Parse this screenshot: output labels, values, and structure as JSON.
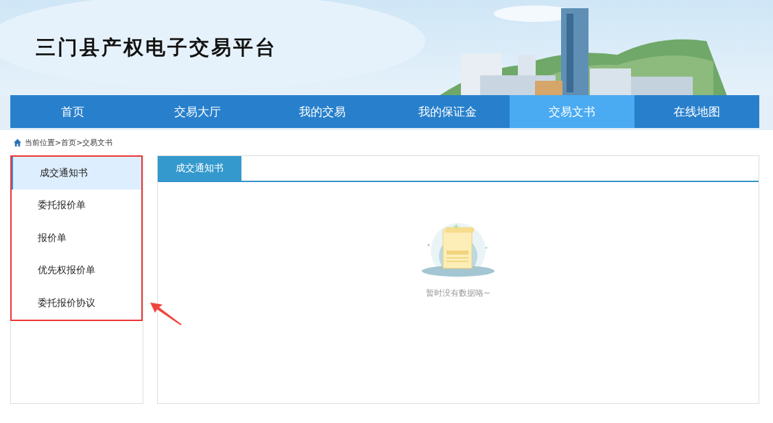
{
  "header": {
    "title": "三门县产权电子交易平台"
  },
  "nav": [
    {
      "label": "首页",
      "selected": false
    },
    {
      "label": "交易大厅",
      "selected": false
    },
    {
      "label": "我的交易",
      "selected": false
    },
    {
      "label": "我的保证金",
      "selected": false
    },
    {
      "label": "交易文书",
      "selected": true
    },
    {
      "label": "在线地图",
      "selected": false
    }
  ],
  "breadcrumb": "当前位置>首页>交易文书",
  "sidebar": {
    "highlighted": true,
    "items": [
      {
        "label": "成交通知书",
        "selected": true
      },
      {
        "label": "委托报价单",
        "selected": false
      },
      {
        "label": "报价单",
        "selected": false
      },
      {
        "label": "优先权报价单",
        "selected": false
      },
      {
        "label": "委托报价协议",
        "selected": false
      }
    ]
  },
  "panel": {
    "tabs": [
      {
        "label": "成交通知书",
        "selected": true
      }
    ],
    "empty_message": "暂时没有数据咯~"
  }
}
